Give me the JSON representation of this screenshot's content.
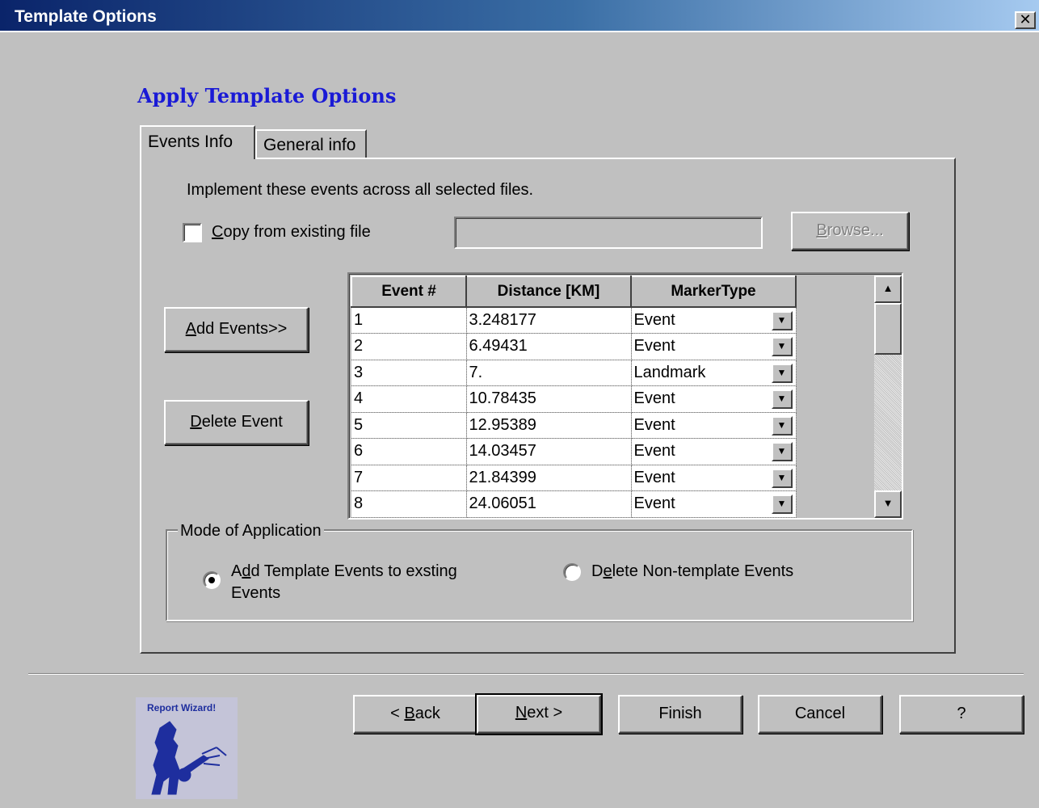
{
  "window": {
    "title": "Template Options",
    "close_glyph": "✕"
  },
  "heading": "Apply Template Options",
  "tabs": [
    {
      "label": "Events Info"
    },
    {
      "label": "General info"
    }
  ],
  "events_info": {
    "instruction": "Implement these events across all selected files.",
    "copy_checkbox": {
      "label_first": "C",
      "label_rest": "opy from existing file",
      "checked": false
    },
    "path_value": "",
    "browse": {
      "label_first": "B",
      "label_rest": "rowse..."
    },
    "add_events": {
      "label_first": "A",
      "label_rest": "dd Events>>"
    },
    "delete_event": {
      "label_first": "D",
      "label_rest": "elete Event"
    }
  },
  "grid": {
    "columns": [
      "Event #",
      "Distance [KM]",
      "MarkerType"
    ],
    "rows": [
      {
        "num": "1",
        "distance": "3.248177",
        "marker": "Event"
      },
      {
        "num": "2",
        "distance": "6.49431",
        "marker": "Event"
      },
      {
        "num": "3",
        "distance": "7.",
        "marker": "Landmark"
      },
      {
        "num": "4",
        "distance": "10.78435",
        "marker": "Event"
      },
      {
        "num": "5",
        "distance": "12.95389",
        "marker": "Event"
      },
      {
        "num": "6",
        "distance": "14.03457",
        "marker": "Event"
      },
      {
        "num": "7",
        "distance": "21.84399",
        "marker": "Event"
      },
      {
        "num": "8",
        "distance": "24.06051",
        "marker": "Event"
      }
    ]
  },
  "mode": {
    "label": "Mode of Application",
    "option_add": {
      "line1_a": "A",
      "line1_u": "d",
      "line1_b": "d Template Events to exsting",
      "line2": "Events",
      "selected": true
    },
    "option_delete": {
      "pre": "D",
      "u": "e",
      "post": "lete Non-template Events",
      "selected": false
    }
  },
  "footer": {
    "logo_text": "Report Wizard!",
    "back": {
      "pre": "< ",
      "u": "B",
      "post": "ack"
    },
    "next": {
      "u": "N",
      "post": "ext >"
    },
    "finish": "Finish",
    "cancel": "Cancel",
    "help": "?"
  }
}
